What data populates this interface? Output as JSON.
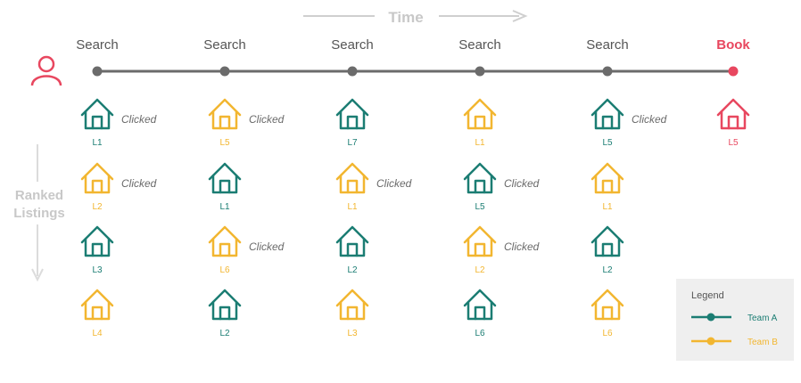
{
  "time_label": "Time",
  "axis_label": [
    "Ranked",
    "Listings"
  ],
  "step_labels": [
    "Search",
    "Search",
    "Search",
    "Search",
    "Search",
    "Book"
  ],
  "clicked_text": "Clicked",
  "colors": {
    "team_a": "#1b7d73",
    "team_b": "#f2b630",
    "book": "#e8475f",
    "timeline": "#6b6b6b",
    "arrow": "#cfcfcf",
    "legend_bg": "#efefef"
  },
  "columns": [
    {
      "step": 0,
      "listings": [
        {
          "label": "L1",
          "team": "a",
          "clicked": true
        },
        {
          "label": "L2",
          "team": "b",
          "clicked": true
        },
        {
          "label": "L3",
          "team": "a",
          "clicked": false
        },
        {
          "label": "L4",
          "team": "b",
          "clicked": false
        }
      ]
    },
    {
      "step": 1,
      "listings": [
        {
          "label": "L5",
          "team": "b",
          "clicked": true
        },
        {
          "label": "L1",
          "team": "a",
          "clicked": false
        },
        {
          "label": "L6",
          "team": "b",
          "clicked": true
        },
        {
          "label": "L2",
          "team": "a",
          "clicked": false
        }
      ]
    },
    {
      "step": 2,
      "listings": [
        {
          "label": "L7",
          "team": "a",
          "clicked": false
        },
        {
          "label": "L1",
          "team": "b",
          "clicked": true
        },
        {
          "label": "L2",
          "team": "a",
          "clicked": false
        },
        {
          "label": "L3",
          "team": "b",
          "clicked": false
        }
      ]
    },
    {
      "step": 3,
      "listings": [
        {
          "label": "L1",
          "team": "b",
          "clicked": false
        },
        {
          "label": "L5",
          "team": "a",
          "clicked": true
        },
        {
          "label": "L2",
          "team": "b",
          "clicked": true
        },
        {
          "label": "L6",
          "team": "a",
          "clicked": false
        }
      ]
    },
    {
      "step": 4,
      "listings": [
        {
          "label": "L5",
          "team": "a",
          "clicked": true
        },
        {
          "label": "L1",
          "team": "b",
          "clicked": false
        },
        {
          "label": "L2",
          "team": "a",
          "clicked": false
        },
        {
          "label": "L6",
          "team": "b",
          "clicked": false
        }
      ]
    },
    {
      "step": 5,
      "listings": [
        {
          "label": "L5",
          "team": "book",
          "clicked": false
        }
      ]
    }
  ],
  "legend": {
    "title": "Legend",
    "items": [
      {
        "label": "Team A",
        "team": "a"
      },
      {
        "label": "Team B",
        "team": "b"
      }
    ]
  },
  "icons": {
    "user": "user-icon",
    "listing": "house-icon"
  }
}
